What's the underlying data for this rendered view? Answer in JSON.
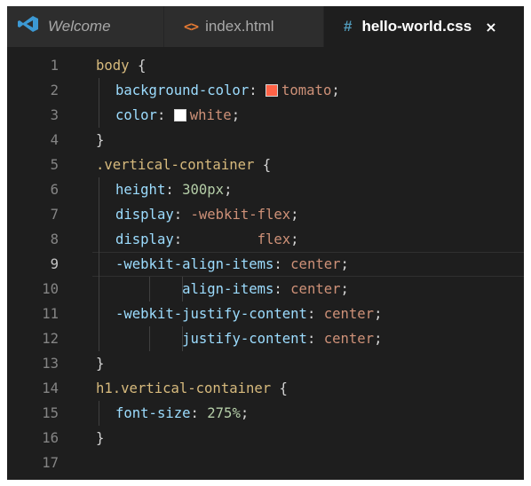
{
  "tabs": [
    {
      "label": "Welcome",
      "icon": "vscode-logo-icon",
      "active": false
    },
    {
      "label": "index.html",
      "icon": "html-brackets-icon",
      "icon_glyph": "<>",
      "active": false
    },
    {
      "label": "hello-world.css",
      "icon": "css-hash-icon",
      "icon_glyph": "#",
      "active": true,
      "close_glyph": "×"
    }
  ],
  "colors": {
    "editor_bg": "#1e1e1e",
    "selector": "#d7ba7d",
    "property": "#9cdcfe",
    "value": "#ce9178",
    "number": "#b5cea8",
    "tomato": "#ff6347",
    "white": "#ffffff"
  },
  "editor": {
    "current_line": 9,
    "lines": [
      {
        "n": "1",
        "tokens": [
          [
            "sel",
            "body"
          ],
          [
            "pun",
            " {"
          ]
        ]
      },
      {
        "n": "2",
        "tokens": [
          [
            "prop",
            "background-color"
          ],
          [
            "pun",
            ": "
          ],
          [
            "swatch",
            "#ff6347"
          ],
          [
            "str",
            "tomato"
          ],
          [
            "pun",
            ";"
          ]
        ]
      },
      {
        "n": "3",
        "tokens": [
          [
            "prop",
            "color"
          ],
          [
            "pun",
            ": "
          ],
          [
            "swatch",
            "#ffffff"
          ],
          [
            "str",
            "white"
          ],
          [
            "pun",
            ";"
          ]
        ]
      },
      {
        "n": "4",
        "tokens": [
          [
            "pun",
            "}"
          ]
        ]
      },
      {
        "n": "5",
        "tokens": [
          [
            "sel",
            ".vertical-container"
          ],
          [
            "pun",
            " {"
          ]
        ]
      },
      {
        "n": "6",
        "tokens": [
          [
            "prop",
            "height"
          ],
          [
            "pun",
            ": "
          ],
          [
            "num",
            "300px"
          ],
          [
            "pun",
            ";"
          ]
        ]
      },
      {
        "n": "7",
        "tokens": [
          [
            "prop",
            "display"
          ],
          [
            "pun",
            ": "
          ],
          [
            "str",
            "-webkit-flex"
          ],
          [
            "pun",
            ";"
          ]
        ]
      },
      {
        "n": "8",
        "tokens": [
          [
            "prop",
            "display"
          ],
          [
            "pun",
            ":         "
          ],
          [
            "str",
            "flex"
          ],
          [
            "pun",
            ";"
          ]
        ]
      },
      {
        "n": "9",
        "tokens": [
          [
            "prop",
            "-webkit-align-items"
          ],
          [
            "pun",
            ": "
          ],
          [
            "str",
            "center"
          ],
          [
            "pun",
            ";"
          ]
        ]
      },
      {
        "n": "10",
        "tokens": [
          [
            "pun",
            "        "
          ],
          [
            "prop",
            "align-items"
          ],
          [
            "pun",
            ": "
          ],
          [
            "str",
            "center"
          ],
          [
            "pun",
            ";"
          ]
        ]
      },
      {
        "n": "11",
        "tokens": [
          [
            "prop",
            "-webkit-justify-content"
          ],
          [
            "pun",
            ": "
          ],
          [
            "str",
            "center"
          ],
          [
            "pun",
            ";"
          ]
        ]
      },
      {
        "n": "12",
        "tokens": [
          [
            "pun",
            "        "
          ],
          [
            "prop",
            "justify-content"
          ],
          [
            "pun",
            ": "
          ],
          [
            "str",
            "center"
          ],
          [
            "pun",
            ";"
          ]
        ]
      },
      {
        "n": "13",
        "tokens": [
          [
            "pun",
            "}"
          ]
        ]
      },
      {
        "n": "14",
        "tokens": [
          [
            "sel",
            "h1.vertical-container"
          ],
          [
            "pun",
            " {"
          ]
        ]
      },
      {
        "n": "15",
        "tokens": [
          [
            "prop",
            "font-size"
          ],
          [
            "pun",
            ": "
          ],
          [
            "num",
            "275%"
          ],
          [
            "pun",
            ";"
          ]
        ]
      },
      {
        "n": "16",
        "tokens": [
          [
            "pun",
            "}"
          ]
        ]
      },
      {
        "n": "17",
        "tokens": []
      }
    ]
  }
}
